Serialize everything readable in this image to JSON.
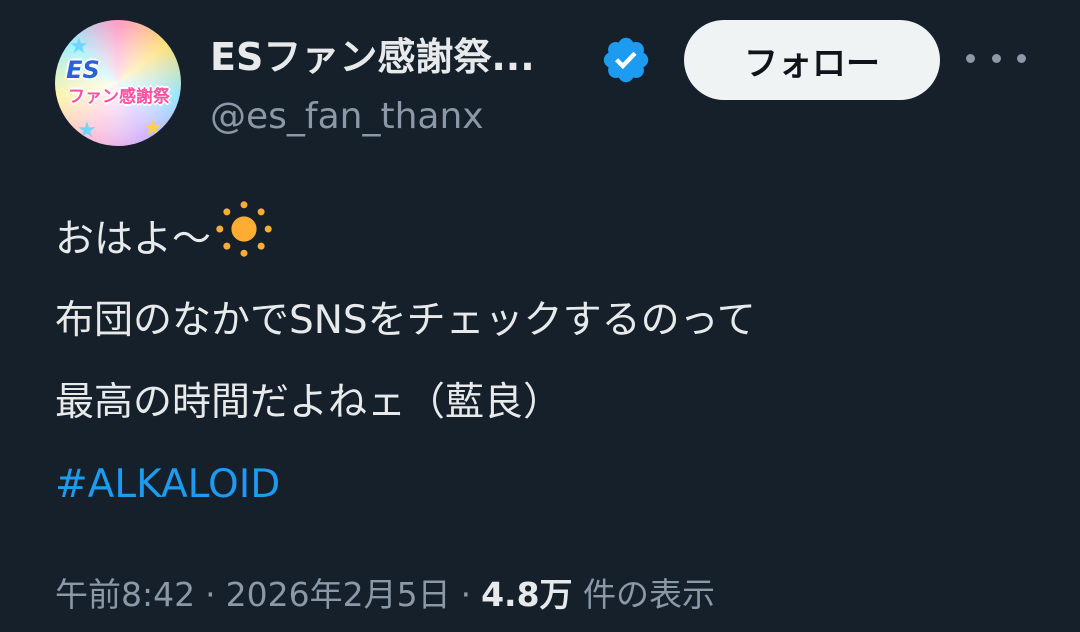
{
  "account": {
    "display_name": "ESファン感謝祭...",
    "handle": "@es_fan_thanx",
    "verified_badge_color": "#1d9bf0",
    "avatar_logo_top": "ES",
    "avatar_logo_main": "ファン感謝祭",
    "avatar_icon": "es-fan-thanx-logo"
  },
  "actions": {
    "follow_label": "フォロー",
    "more_icon": "more-horizontal-icon"
  },
  "tweet": {
    "line1": "おはよ〜",
    "emoji": "sun-emoji",
    "line2": "布団のなかでSNSをチェックするのって",
    "line3": "最高の時間だよねェ（藍良）",
    "hashtag": "#ALKALOID"
  },
  "meta": {
    "time": "午前8:42",
    "separator": "·",
    "date": "2026年2月5日",
    "views_count": "4.8万",
    "views_label": " 件の表示"
  },
  "colors": {
    "background": "#15202b",
    "text_primary": "#e7e9ea",
    "text_secondary": "#8b98a5",
    "link": "#1d9bf0",
    "button_bg": "#eff3f4"
  }
}
